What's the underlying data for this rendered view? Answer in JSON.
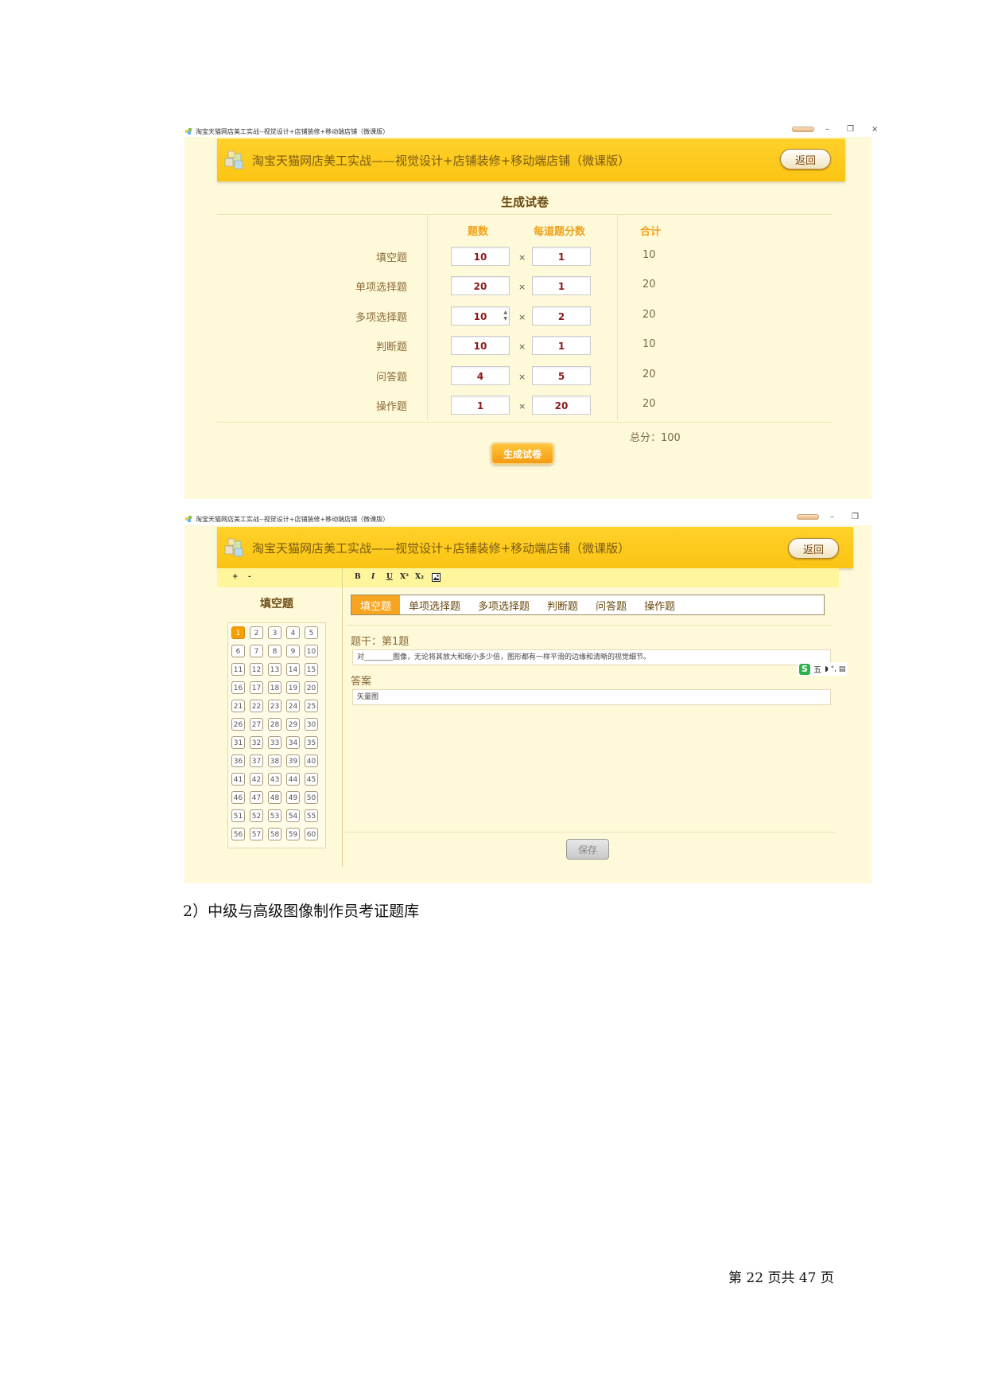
{
  "window_title": "淘宝天猫网店美工实战--视觉设计+店铺装修+移动端店铺（微课版）",
  "app_title": "淘宝天猫网店美工实战——视觉设计+店铺装修+移动端店铺（微课版）",
  "back_label": "返回",
  "window_controls": {
    "minimize": "–",
    "maximize": "❐",
    "close": "×"
  },
  "exam": {
    "title": "生成试卷",
    "headers": {
      "count": "题数",
      "score": "每道题分数",
      "total": "合计"
    },
    "times_symbol": "×",
    "rows": [
      {
        "label": "填空题",
        "count": "10",
        "score": "1",
        "total": "10"
      },
      {
        "label": "单项选择题",
        "count": "20",
        "score": "1",
        "total": "20"
      },
      {
        "label": "多项选择题",
        "count": "10",
        "score": "2",
        "total": "20"
      },
      {
        "label": "判断题",
        "count": "10",
        "score": "1",
        "total": "10"
      },
      {
        "label": "问答题",
        "count": "4",
        "score": "5",
        "total": "20"
      },
      {
        "label": "操作题",
        "count": "1",
        "score": "20",
        "total": "20"
      }
    ],
    "total_score": "总分：100",
    "generate_label": "生成试卷"
  },
  "editor": {
    "zoom_in": "+",
    "zoom_out": "-",
    "toolbar": {
      "bold": "B",
      "italic": "I",
      "underline": "U",
      "superscript": "X²",
      "subscript": "X₂"
    },
    "panel_title": "填空题",
    "tabs": [
      "填空题",
      "单项选择题",
      "多项选择题",
      "判断题",
      "问答题",
      "操作题"
    ],
    "active_tab": 0,
    "question_numbers": [
      "1",
      "2",
      "3",
      "4",
      "5",
      "6",
      "7",
      "8",
      "9",
      "10",
      "11",
      "12",
      "13",
      "14",
      "15",
      "16",
      "17",
      "18",
      "19",
      "20",
      "21",
      "22",
      "23",
      "24",
      "25",
      "26",
      "27",
      "28",
      "29",
      "30",
      "31",
      "32",
      "33",
      "34",
      "35",
      "36",
      "37",
      "38",
      "39",
      "40",
      "41",
      "42",
      "43",
      "44",
      "45",
      "46",
      "47",
      "48",
      "49",
      "50",
      "51",
      "52",
      "53",
      "54",
      "55",
      "56",
      "57",
      "58",
      "59",
      "60"
    ],
    "active_question": 0,
    "stem_label": "题干：第1题",
    "stem_text": "对________图像，无论将其放大和缩小多少倍，图形都有一样平滑的边缘和清晰的视觉细节。",
    "answer_label": "答案",
    "answer_text": "矢量图",
    "save_label": "保存",
    "ime": {
      "logo": "S",
      "mode": "五",
      "extra": "◗ °, ▤"
    }
  },
  "doc": {
    "section_heading": "2）中级与高级图像制作员考证题库",
    "footer": "第 22 页共 47 页"
  }
}
